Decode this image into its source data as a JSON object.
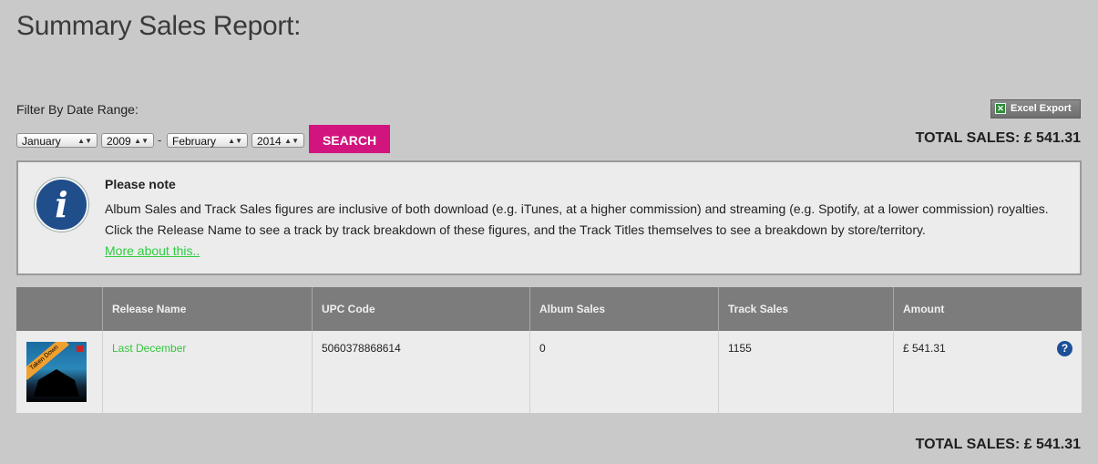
{
  "page_title": "Summary Sales Report:",
  "filter": {
    "label": "Filter By Date Range:",
    "from_month": "January",
    "from_year": "2009",
    "separator": "-",
    "to_month": "February",
    "to_year": "2014",
    "search_label": "SEARCH"
  },
  "excel_export_label": "Excel Export",
  "total_sales": "TOTAL SALES: £ 541.31",
  "note": {
    "title": "Please note",
    "line1": "Album Sales and Track Sales figures are inclusive of both download (e.g. iTunes, at a higher commission) and streaming (e.g. Spotify, at a lower commission) royalties.",
    "line2": "Click the Release Name to see a track by track breakdown of these figures, and the Track Titles themselves to see a breakdown by store/territory.",
    "link": "More about this.."
  },
  "table": {
    "headers": [
      "",
      "Release Name",
      "UPC Code",
      "Album Sales",
      "Track Sales",
      "Amount"
    ],
    "rows": [
      {
        "cover_ribbon": "Taken Down",
        "release_name": "Last December",
        "upc": "5060378868614",
        "album_sales": "0",
        "track_sales": "1155",
        "amount": "£ 541.31"
      }
    ]
  },
  "colors": {
    "background": "#c9c9c9",
    "accent": "#d2147e",
    "link": "#36c43c",
    "header": "#7c7c7c",
    "info": "#1f4e8a"
  },
  "icons": {
    "info": "info-icon",
    "excel": "excel-icon",
    "help": "help-icon"
  }
}
